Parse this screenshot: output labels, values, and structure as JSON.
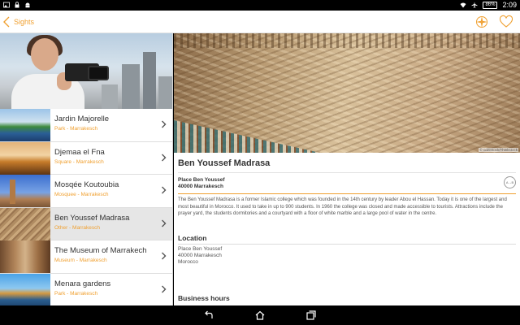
{
  "status_bar": {
    "time": "2:09",
    "battery": "86%",
    "icons_left": [
      "image-icon",
      "lock-icon",
      "android-icon"
    ],
    "icons_right": [
      "wifi-icon",
      "airplane-icon",
      "battery-icon"
    ]
  },
  "app_bar": {
    "title": "Sights",
    "accent_color": "#f0a030"
  },
  "sights": [
    {
      "name": "Jardin Majorelle",
      "subtitle": "Park - Marrakesch",
      "selected": false
    },
    {
      "name": "Djemaa el Fna",
      "subtitle": "Square - Marrakesch",
      "selected": false
    },
    {
      "name": "Mosqée Koutoubia",
      "subtitle": "Mosquee - Marrakesch",
      "selected": false
    },
    {
      "name": "Ben Youssef Madrasa",
      "subtitle": "Other - Marrakesch",
      "selected": true
    },
    {
      "name": "The Museum of Marrakech",
      "subtitle": "Museum - Marrakesch",
      "selected": false
    },
    {
      "name": "Menara gardens",
      "subtitle": "Park - Marrakesch",
      "selected": false
    }
  ],
  "detail": {
    "image_credit": "© cdi/iStock/Thinkstock",
    "title": "Ben Youssef Madrasa",
    "address_line1": "Place Ben Youssef",
    "address_line2": "40000 Marrakesch",
    "route_label": "A→B",
    "description": "The Ben Youssef Madrasa is a former Islamic college which was founded in the 14th century by leader Abou el Hassan. Today it is one of the largest and most beautiful in Morocco. It used to take in up to 900 students. In 1960 the college was closed and made accessible to tourists. Attractions include the prayer yard, the students dormitories and a courtyard with a floor of white marble and a large pool of water in the centre.",
    "location": {
      "heading": "Location",
      "lines": [
        "Place Ben Youssef",
        "40000 Marrakesch",
        "Morocco"
      ]
    },
    "business_hours": {
      "heading": "Business hours"
    }
  },
  "nav_bar": {
    "buttons": [
      "back-icon",
      "home-icon",
      "recent-apps-icon"
    ]
  }
}
